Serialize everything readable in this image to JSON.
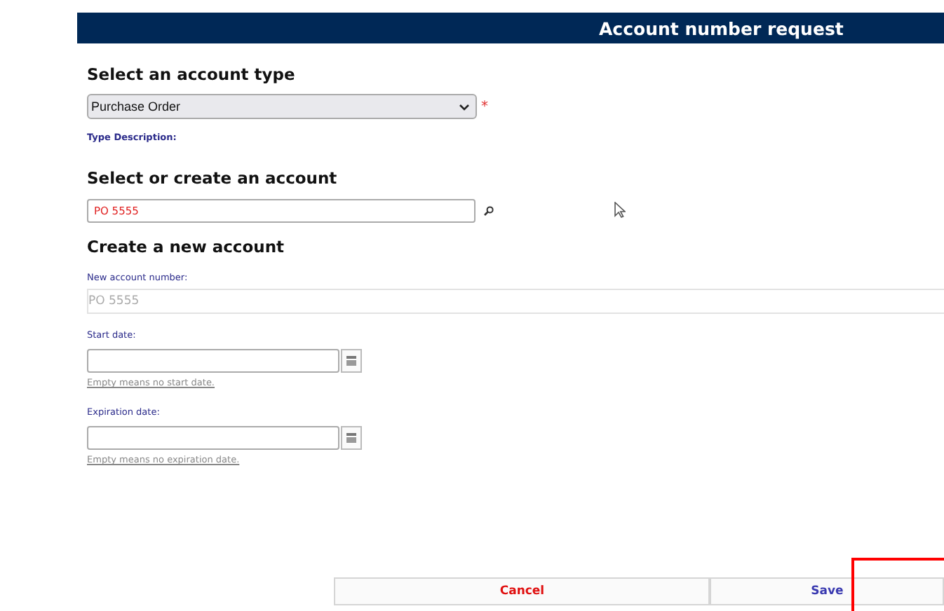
{
  "header": {
    "title": "Account number request"
  },
  "account_type": {
    "heading": "Select an account type",
    "value": "Purchase Order",
    "required_mark": "*",
    "description_label": "Type Description:"
  },
  "account_select": {
    "heading": "Select or create an account",
    "value": "PO 5555"
  },
  "new_account": {
    "heading": "Create a new account",
    "number_label": "New account number:",
    "number_placeholder": "PO 5555",
    "dates": [
      {
        "label": "Start date:",
        "hint": "Empty means no start date."
      },
      {
        "label": "Expiration date:",
        "hint": "Empty means no expiration date."
      }
    ]
  },
  "buttons": [
    {
      "label": "Cancel",
      "kind": "cancel"
    },
    {
      "label": "Save",
      "kind": "save"
    }
  ],
  "annotations": [
    {
      "kind": "frame"
    }
  ]
}
